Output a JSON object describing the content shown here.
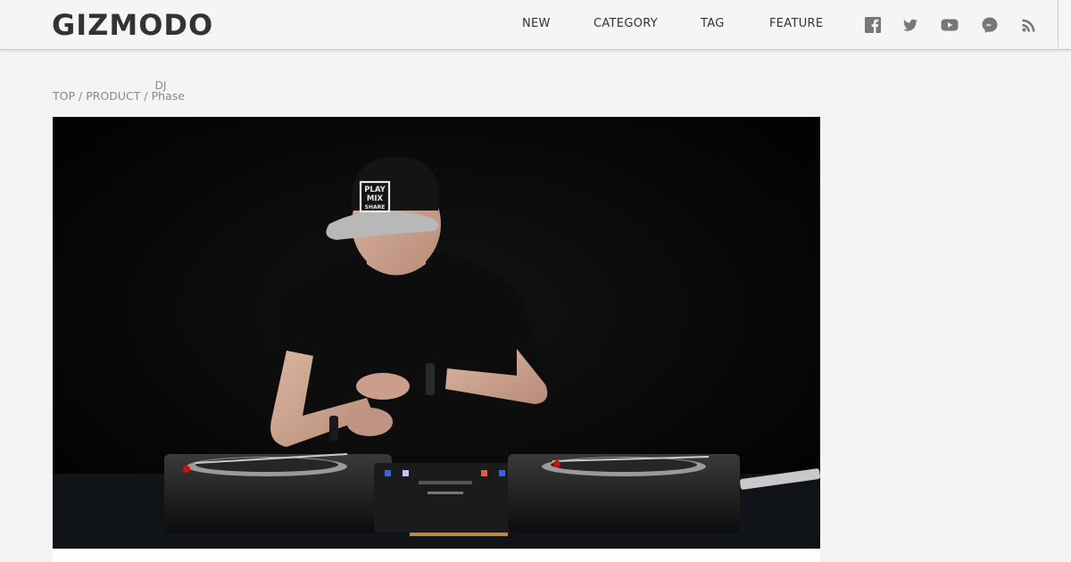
{
  "header": {
    "logo": "GIZMODO",
    "nav": [
      "NEW",
      "CATEGORY",
      "TAG",
      "FEATURE"
    ],
    "social": [
      "facebook-icon",
      "twitter-icon",
      "youtube-icon",
      "messenger-icon",
      "rss-icon"
    ]
  },
  "breadcrumb": {
    "items": [
      "TOP",
      "PRODUCT"
    ],
    "separator": "/",
    "current_top": "DJ",
    "current": "Phase"
  },
  "hero": {
    "cap_text": [
      "PLAY",
      "MIX",
      "SHARE"
    ]
  },
  "colors": {
    "header_bg": "#f5f5f5",
    "page_bg": "#f4f4f4",
    "text": "#333333",
    "muted": "#888888",
    "icon": "#777777"
  }
}
